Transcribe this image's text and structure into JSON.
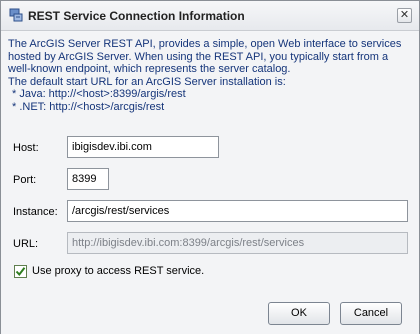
{
  "window": {
    "title": "REST Service Connection Information",
    "close_glyph": "✕"
  },
  "info": {
    "lines": [
      "The ArcGIS Server REST API, provides a simple, open Web interface to services",
      "hosted by ArcGIS Server. When using the REST API, you typically start from a",
      "well-known endpoint, which represents the server catalog.",
      "The default start URL for an ArcGIS Server installation is:",
      "  * Java: http://<host>:8399/argis/rest",
      "  * .NET: http://<host>/arcgis/rest"
    ]
  },
  "form": {
    "host": {
      "label": "Host:",
      "value": "ibigisdev.ibi.com"
    },
    "port": {
      "label": "Port:",
      "value": "8399"
    },
    "instance": {
      "label": "Instance:",
      "value": "/arcgis/rest/services"
    },
    "url": {
      "label": "URL:",
      "value": "http://ibigisdev.ibi.com:8399/arcgis/rest/services"
    },
    "proxy": {
      "label": "Use proxy to access REST service.",
      "checked": true
    }
  },
  "buttons": {
    "ok": "OK",
    "cancel": "Cancel"
  },
  "icons": {
    "title": "network-service-icon",
    "checkbox": "checkmark-icon"
  },
  "colors": {
    "info_text": "#15357a",
    "checkmark": "#2e7d1f"
  }
}
